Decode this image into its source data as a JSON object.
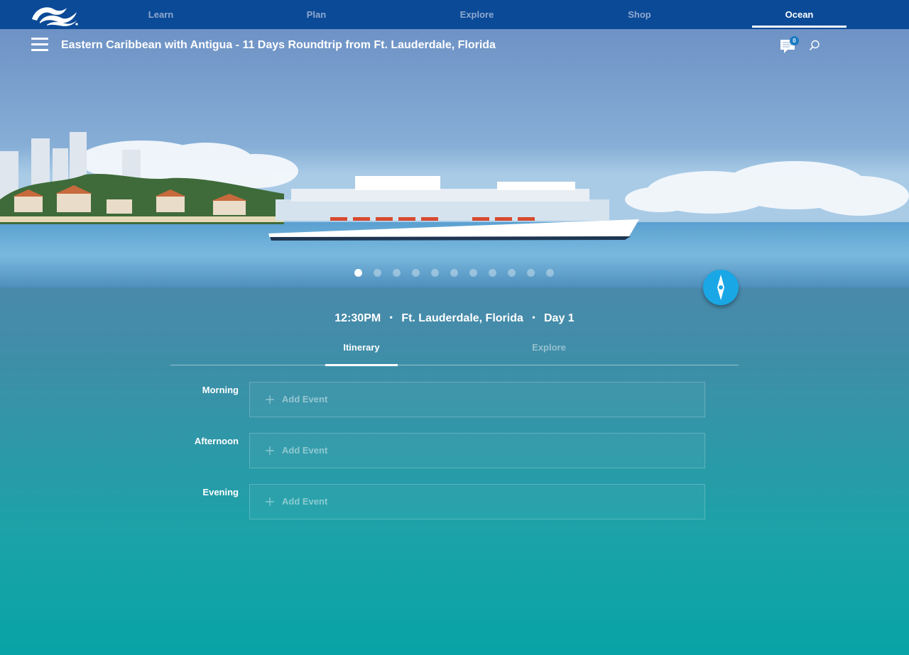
{
  "nav": {
    "logo": "princess-wave-logo",
    "items": [
      {
        "label": "Learn",
        "active": false
      },
      {
        "label": "Plan",
        "active": false
      },
      {
        "label": "Explore",
        "active": false
      },
      {
        "label": "Shop",
        "active": false
      },
      {
        "label": "Ocean",
        "active": true
      }
    ]
  },
  "header": {
    "menu_icon": "hamburger-icon",
    "title": "Eastern Caribbean with Antigua - 11 Days Roundtrip from Ft. Lauderdale, Florida",
    "chat_count": "0",
    "chat_icon": "chat-icon",
    "search_icon": "search-icon"
  },
  "carousel": {
    "total_slides": 11,
    "active_slide": 1
  },
  "day": {
    "time": "12:30PM",
    "location": "Ft. Lauderdale, Florida",
    "day_label": "Day 1",
    "separator": "•"
  },
  "tabs": [
    {
      "label": "Itinerary",
      "active": true
    },
    {
      "label": "Explore",
      "active": false
    }
  ],
  "periods": [
    {
      "label": "Morning",
      "action": "Add Event"
    },
    {
      "label": "Afternoon",
      "action": "Add Event"
    },
    {
      "label": "Evening",
      "action": "Add Event"
    }
  ],
  "colors": {
    "nav_bg": "#0b4a97",
    "compass": "#1aa7e6",
    "badge": "#1a7ac2"
  }
}
